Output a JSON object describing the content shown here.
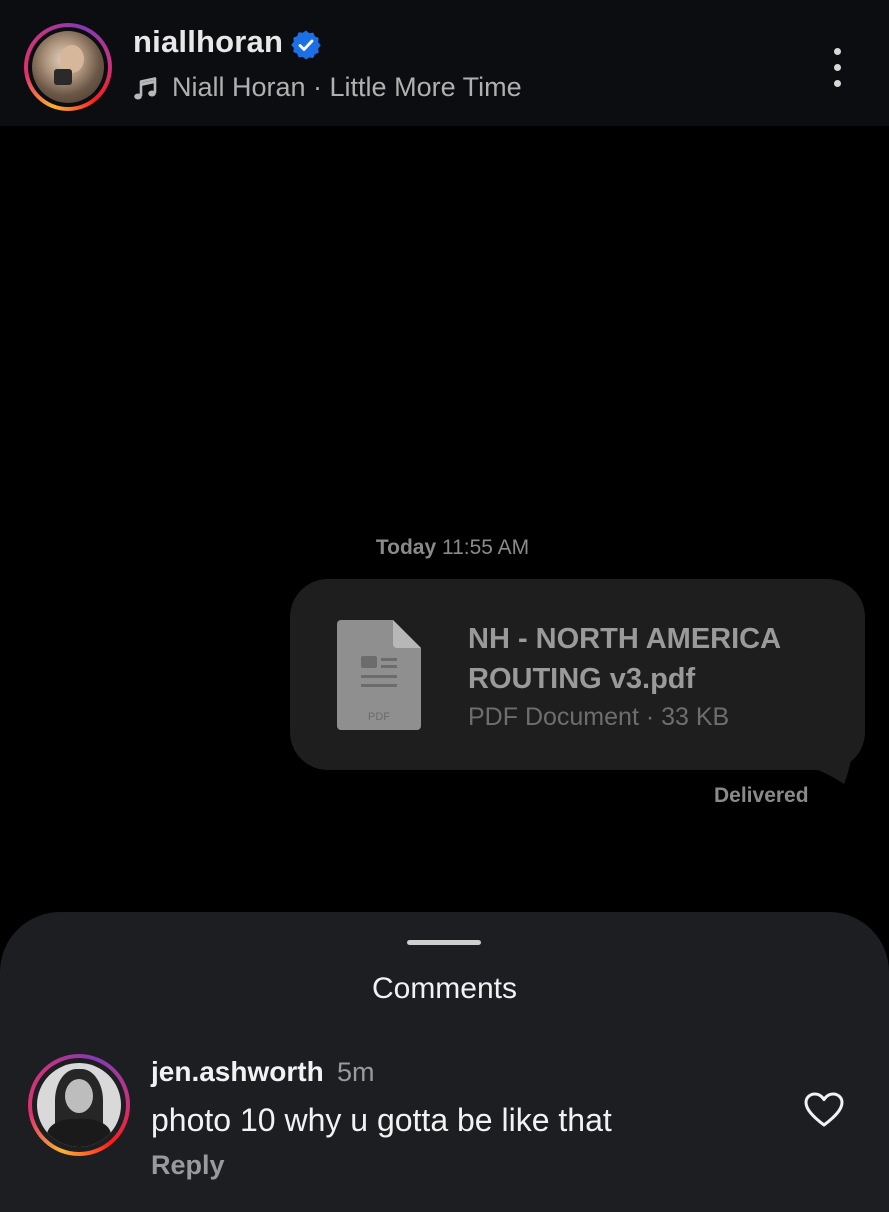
{
  "header": {
    "username": "niallhoran",
    "music_label": "Niall Horan · Little More Time",
    "icons": {
      "avatar": "profile-avatar",
      "verified": "verified-badge-icon",
      "music": "music-note-icon",
      "more": "more-options-icon"
    }
  },
  "chat": {
    "timestamp_day": "Today",
    "timestamp_time": "11:55 AM",
    "attachment": {
      "file_name": "NH - NORTH AMERICA ROUTING v3.pdf",
      "file_meta": "PDF Document · 33 KB",
      "icon_label": "PDF"
    },
    "status": "Delivered"
  },
  "comments": {
    "title": "Comments",
    "items": [
      {
        "username": "jen.ashworth",
        "time": "5m",
        "text": "photo 10 why u gotta be like that",
        "reply_label": "Reply"
      }
    ]
  },
  "colors": {
    "accent_verified": "#1d6fe8",
    "sheet_background": "#1c1e22",
    "bubble_background": "#1e1e1f"
  }
}
